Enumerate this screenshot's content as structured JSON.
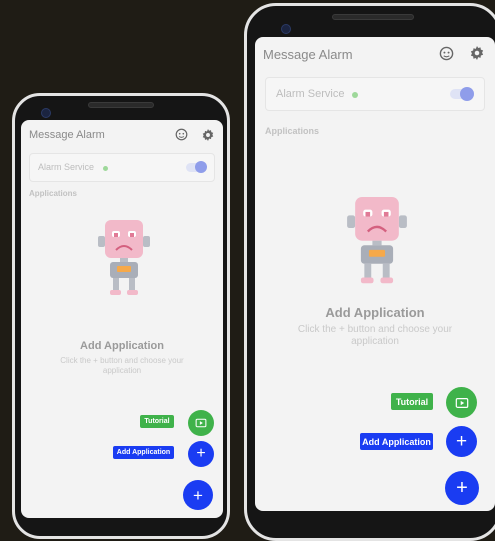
{
  "app": {
    "title": "Message Alarm"
  },
  "service": {
    "label": "Alarm Service",
    "status_color": "#9ed89a",
    "enabled": true
  },
  "section": {
    "applications": "Applications"
  },
  "empty_state": {
    "title": "Add Application",
    "description": "Click the + button and choose your application"
  },
  "fab_menu": {
    "tutorial_label": "Tutorial",
    "add_label": "Add Application"
  },
  "icons": {
    "header_left": "robot-face-icon",
    "header_right": "gear-icon",
    "tutorial": "video-icon",
    "add": "plus-icon",
    "main": "plus-icon"
  },
  "colors": {
    "primary": "#1a3cf2",
    "secondary": "#3fb24a",
    "background": "#f3f3f3"
  }
}
